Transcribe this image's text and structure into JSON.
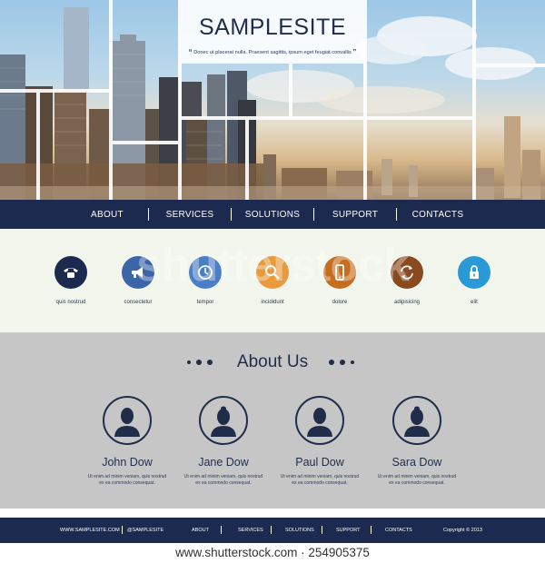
{
  "hero": {
    "title": "SAMPLESITE",
    "tagline": "Donec ut placerat nulla. Praesent sagittis, ipsum eget feugiat convallis"
  },
  "nav": {
    "items": [
      "ABOUT",
      "SERVICES",
      "SOLUTIONS",
      "SUPPORT",
      "CONTACTS"
    ]
  },
  "features": [
    {
      "label": "quis nostrud",
      "icon": "phone-icon",
      "color": "#1b2a4e"
    },
    {
      "label": "consectetur",
      "icon": "megaphone-icon",
      "color": "#3c64a8"
    },
    {
      "label": "tempor",
      "icon": "clock-icon",
      "color": "#4a7ec6"
    },
    {
      "label": "incididunt",
      "icon": "search-icon",
      "color": "#e89a3c"
    },
    {
      "label": "dolore",
      "icon": "mobile-icon",
      "color": "#c76d1f"
    },
    {
      "label": "adipisicing",
      "icon": "refresh-icon",
      "color": "#8a4a20"
    },
    {
      "label": "elit",
      "icon": "lock-icon",
      "color": "#2a9ad6"
    }
  ],
  "about": {
    "title": "About Us",
    "team": [
      {
        "name": "John Dow",
        "desc_line1": "Ut enim ad minim veniam, quis nostrud",
        "desc_line2": "ex ea commodo consequat."
      },
      {
        "name": "Jane Dow",
        "desc_line1": "Ut enim ad minim veniam, quis nostrud",
        "desc_line2": "ex ea commodo consequat."
      },
      {
        "name": "Paul Dow",
        "desc_line1": "Ut enim ad minim veniam, quis nostrud",
        "desc_line2": "ex ea commodo consequat."
      },
      {
        "name": "Sara Dow",
        "desc_line1": "Ut enim ad minim veniam, quis nostrud",
        "desc_line2": "ex ea commodo consequat."
      }
    ]
  },
  "footer": {
    "url": "WWW.SAMPLESITE.COM",
    "handle": "@SAMPLESITE",
    "links": [
      "ABOUT",
      "SERVICES",
      "SOLUTIONS",
      "SUPPORT",
      "CONTACTS"
    ],
    "copyright": "Copyright © 2013"
  },
  "watermark": {
    "overlay_text": "shutterstock",
    "bottom_text": "www.shutterstock.com · 254905375"
  },
  "colors": {
    "navy": "#1b2a4e",
    "panel": "#f2f5ec",
    "about_bg": "#c6c6c6"
  }
}
